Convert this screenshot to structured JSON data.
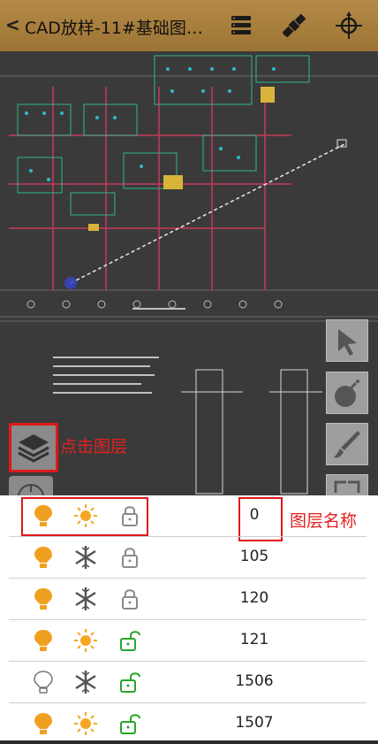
{
  "header": {
    "back_label": "<",
    "title": "CAD放样-11#基础图…",
    "menu_icon": "list-icon",
    "satellite_icon": "satellite-icon",
    "locate_icon": "crosshair-icon"
  },
  "canvas": {
    "tools": [
      "cursor-icon",
      "bomb-icon",
      "brush-icon",
      "expand-icon"
    ],
    "layer_button_icon": "layers-icon",
    "annotation_layer": "点击图层",
    "annotation_name": "图层名称"
  },
  "layers": [
    {
      "name": "0",
      "bulb": "on",
      "state": "sun",
      "lock": "locked"
    },
    {
      "name": "105",
      "bulb": "on",
      "state": "snow",
      "lock": "locked"
    },
    {
      "name": "120",
      "bulb": "on",
      "state": "snow",
      "lock": "locked"
    },
    {
      "name": "121",
      "bulb": "on",
      "state": "sun",
      "lock": "unlocked"
    },
    {
      "name": "1506",
      "bulb": "off",
      "state": "snow",
      "lock": "unlocked"
    },
    {
      "name": "1507",
      "bulb": "on",
      "state": "sun",
      "lock": "unlocked"
    }
  ],
  "colors": {
    "accent": "#a8813e",
    "bulb_on": "#f0a020",
    "sun": "#f5a623",
    "unlocked": "#2aa52a",
    "annotation": "#e42020"
  }
}
